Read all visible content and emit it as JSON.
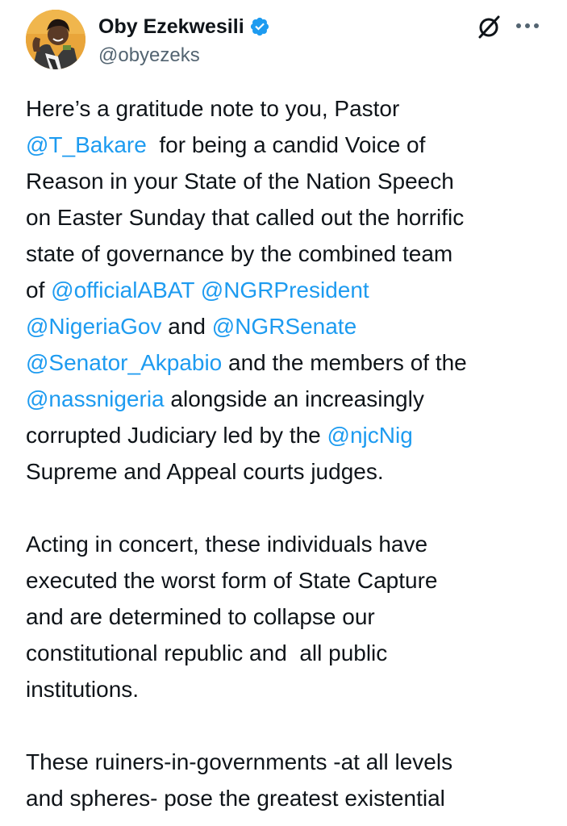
{
  "author": {
    "display_name": "Oby Ezekwesili",
    "handle": "@obyezeks",
    "verified": true,
    "avatar_icon": "profile-photo"
  },
  "actions": {
    "grok_icon": "grok-icon",
    "more_icon": "more-horizontal-icon"
  },
  "colors": {
    "link": "#1d9bf0",
    "text": "#0f1419",
    "secondary": "#536471",
    "verified_badge": "#1d9bf0"
  },
  "tweet": {
    "paragraphs": [
      {
        "lines": [
          [
            {
              "t": "Here’s a gratitude note to you, Pastor"
            }
          ],
          [
            {
              "t": "@T_Bakare",
              "m": true
            },
            {
              "t": "  for being a candid Voice of"
            }
          ],
          [
            {
              "t": "Reason in your State of the Nation Speech"
            }
          ],
          [
            {
              "t": "on Easter Sunday that called out the horrific"
            }
          ],
          [
            {
              "t": "state of governance by the combined team"
            }
          ],
          [
            {
              "t": "of "
            },
            {
              "t": "@officialABAT",
              "m": true
            },
            {
              "t": " "
            },
            {
              "t": "@NGRPresident",
              "m": true
            }
          ],
          [
            {
              "t": "@NigeriaGov",
              "m": true
            },
            {
              "t": " and "
            },
            {
              "t": "@NGRSenate",
              "m": true
            }
          ],
          [
            {
              "t": "@Senator_Akpabio",
              "m": true
            },
            {
              "t": " and the members of the"
            }
          ],
          [
            {
              "t": "@nassnigeria",
              "m": true
            },
            {
              "t": " alongside an increasingly"
            }
          ],
          [
            {
              "t": "corrupted Judiciary led by the "
            },
            {
              "t": "@njcNig",
              "m": true
            }
          ],
          [
            {
              "t": "Supreme and Appeal courts judges."
            }
          ]
        ]
      },
      {
        "lines": [
          [
            {
              "t": "Acting in concert, these individuals have"
            }
          ],
          [
            {
              "t": "executed the worst form of State Capture"
            }
          ],
          [
            {
              "t": "and are determined to collapse our"
            }
          ],
          [
            {
              "t": "constitutional republic and  all public"
            }
          ],
          [
            {
              "t": "institutions."
            }
          ]
        ]
      },
      {
        "lines": [
          [
            {
              "t": "These ruiners-in-governments -at all levels"
            }
          ],
          [
            {
              "t": "and spheres- pose the greatest existential"
            }
          ]
        ]
      }
    ]
  }
}
